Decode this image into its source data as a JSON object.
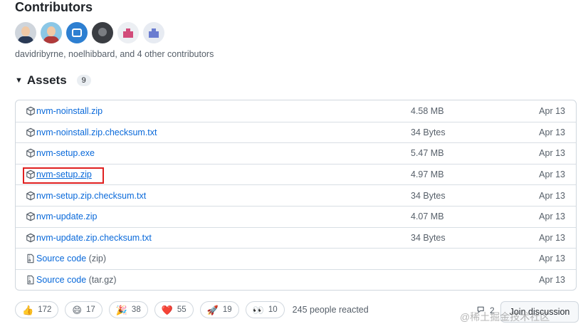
{
  "contributors": {
    "title": "Contributors",
    "summary": "davidribyrne, noelhibbard, and 4 other contributors",
    "avatars": [
      "avatar-davidribyrne",
      "avatar-noelhibbard",
      "avatar-bot",
      "avatar-contributor-4",
      "avatar-contributor-5",
      "avatar-contributor-6"
    ]
  },
  "assets": {
    "title": "Assets",
    "count": "9",
    "caret_icon": "triangle-down-icon",
    "package_icon": "package-icon",
    "zip_icon": "file-zip-icon",
    "highlight_color": "#e02020",
    "link_color": "#0969da",
    "items": [
      {
        "name": "nvm-noinstall.zip",
        "size": "4.58 MB",
        "date": "Apr 13"
      },
      {
        "name": "nvm-noinstall.zip.checksum.txt",
        "size": "34 Bytes",
        "date": "Apr 13"
      },
      {
        "name": "nvm-setup.exe",
        "size": "5.47 MB",
        "date": "Apr 13"
      },
      {
        "name": "nvm-setup.zip",
        "size": "4.97 MB",
        "date": "Apr 13"
      },
      {
        "name": "nvm-setup.zip.checksum.txt",
        "size": "34 Bytes",
        "date": "Apr 13"
      },
      {
        "name": "nvm-update.zip",
        "size": "4.07 MB",
        "date": "Apr 13"
      },
      {
        "name": "nvm-update.zip.checksum.txt",
        "size": "34 Bytes",
        "date": "Apr 13"
      },
      {
        "name": "Source code",
        "sub": "(zip)",
        "size": "",
        "date": "Apr 13"
      },
      {
        "name": "Source code",
        "sub": "(tar.gz)",
        "size": "",
        "date": "Apr 13"
      }
    ]
  },
  "reactions": {
    "items": [
      {
        "emoji": "👍",
        "icon": "thumbs-up-icon",
        "count": "172"
      },
      {
        "emoji": "😄",
        "icon": "laugh-icon",
        "count": "17"
      },
      {
        "emoji": "🎉",
        "icon": "hooray-icon",
        "count": "38"
      },
      {
        "emoji": "❤️",
        "icon": "heart-icon",
        "count": "55"
      },
      {
        "emoji": "🚀",
        "icon": "rocket-icon",
        "count": "19"
      },
      {
        "emoji": "👀",
        "icon": "eyes-icon",
        "count": "10"
      }
    ],
    "summary": "245 people reacted"
  },
  "discussion": {
    "count": "2",
    "icon": "comment-discussion-icon",
    "join_label": "Join discussion"
  },
  "watermark": "@稀土掘金技术社区"
}
